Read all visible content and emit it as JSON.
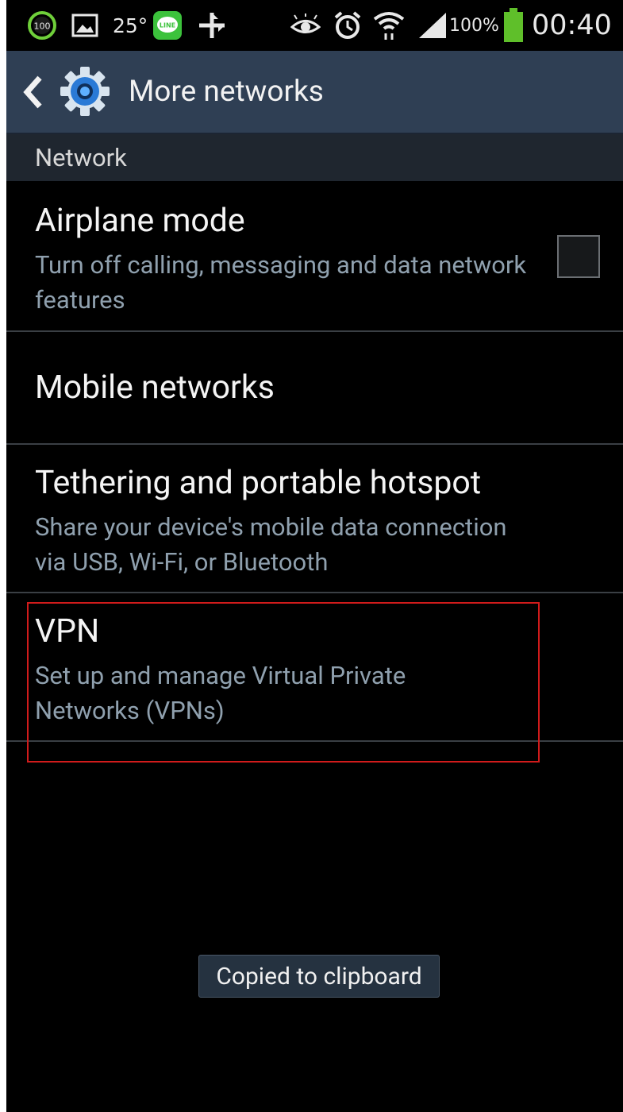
{
  "status_bar": {
    "battery_saver_badge": "100",
    "temperature": "25°",
    "line_app_label": "LINE",
    "battery_percent": "100%",
    "time": "00:40",
    "icons": [
      "battery-saver-100-icon",
      "gallery-icon",
      "temperature-text",
      "line-app-icon",
      "transfer-arrows-icon",
      "eye-icon",
      "alarm-icon",
      "wifi-icon",
      "signal-icon",
      "battery-icon"
    ]
  },
  "action_bar": {
    "title": "More networks",
    "back_icon": "chevron-left-icon",
    "app_icon": "settings-gear-icon"
  },
  "section": {
    "header": "Network"
  },
  "items": [
    {
      "title": "Airplane mode",
      "subtitle": "Turn off calling, messaging and data network features",
      "checkbox_checked": false
    },
    {
      "title": "Mobile networks"
    },
    {
      "title": "Tethering and portable hotspot",
      "subtitle": "Share your device's mobile data connection via USB, Wi-Fi, or Bluetooth"
    },
    {
      "title": "VPN",
      "subtitle": "Set up and manage Virtual Private Networks (VPNs)"
    }
  ],
  "toast": {
    "message": "Copied to clipboard"
  },
  "colors": {
    "action_bar_bg": "#2f3f54",
    "section_header_bg": "#1f262f",
    "subtitle_text": "#8fa0ae",
    "highlight_border": "#d11b1b",
    "battery_green": "#5fbf2a",
    "line_green": "#3cc23c"
  }
}
